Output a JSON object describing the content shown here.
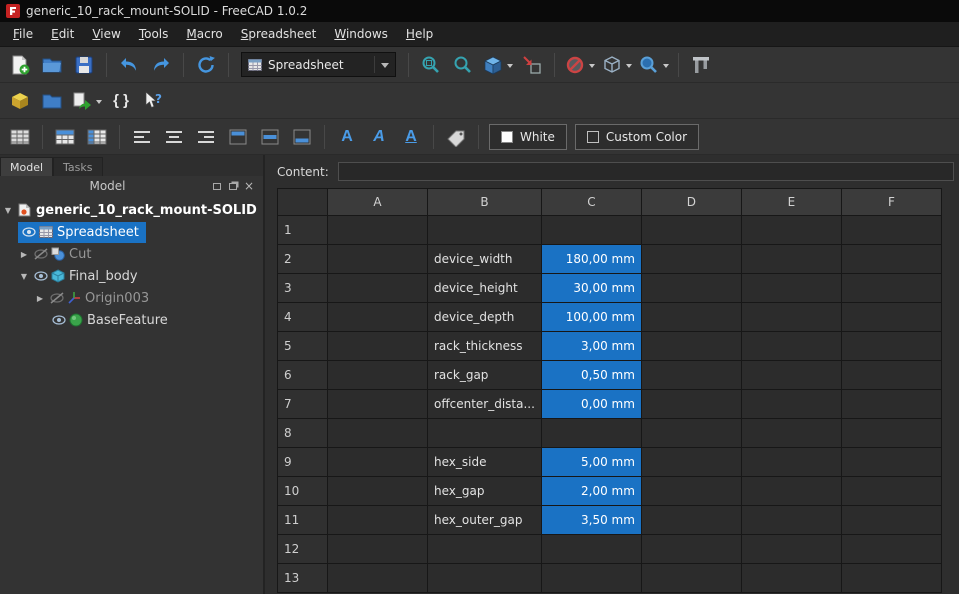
{
  "colors": {
    "selection_blue": "#1a72c4",
    "titlebar": "#0a0a0a",
    "toolbar": "#343434",
    "grid_background": "#2c2c2c"
  },
  "window": {
    "title": "generic_10_rack_mount-SOLID - FreeCAD 1.0.2"
  },
  "menu": {
    "items": [
      "File",
      "Edit",
      "View",
      "Tools",
      "Macro",
      "Spreadsheet",
      "Windows",
      "Help"
    ]
  },
  "toolbar": {
    "workbench_selector_value": "Spreadsheet",
    "white_button_label": "White",
    "custom_color_button_label": "Custom Color"
  },
  "left_panel": {
    "tabs": {
      "model": "Model",
      "tasks": "Tasks"
    },
    "header_title": "Model",
    "tree": {
      "root_label": "generic_10_rack_mount-SOLID",
      "items": [
        {
          "label": "Spreadsheet",
          "selected": true,
          "visible": true
        },
        {
          "label": "Cut",
          "selected": false,
          "visible": false
        },
        {
          "label": "Final_body",
          "selected": false,
          "visible": true
        },
        {
          "label": "Origin003",
          "selected": false,
          "visible": false
        },
        {
          "label": "BaseFeature",
          "selected": false,
          "visible": true
        }
      ]
    }
  },
  "spreadsheet": {
    "content_label": "Content:",
    "content_value": "",
    "columns": [
      "A",
      "B",
      "C",
      "D",
      "E",
      "F"
    ],
    "rows": [
      {
        "num": "1",
        "b": "",
        "c": ""
      },
      {
        "num": "2",
        "b": "device_width",
        "c": "180,00 mm"
      },
      {
        "num": "3",
        "b": "device_height",
        "c": "30,00 mm"
      },
      {
        "num": "4",
        "b": "device_depth",
        "c": "100,00 mm"
      },
      {
        "num": "5",
        "b": "rack_thickness",
        "c": "3,00 mm"
      },
      {
        "num": "6",
        "b": "rack_gap",
        "c": "0,50 mm"
      },
      {
        "num": "7",
        "b": "offcenter_dista...",
        "c": "0,00 mm"
      },
      {
        "num": "8",
        "b": "",
        "c": ""
      },
      {
        "num": "9",
        "b": "hex_side",
        "c": "5,00 mm"
      },
      {
        "num": "10",
        "b": "hex_gap",
        "c": "2,00 mm"
      },
      {
        "num": "11",
        "b": "hex_outer_gap",
        "c": "3,50 mm"
      },
      {
        "num": "12",
        "b": "",
        "c": ""
      },
      {
        "num": "13",
        "b": "",
        "c": ""
      }
    ]
  }
}
